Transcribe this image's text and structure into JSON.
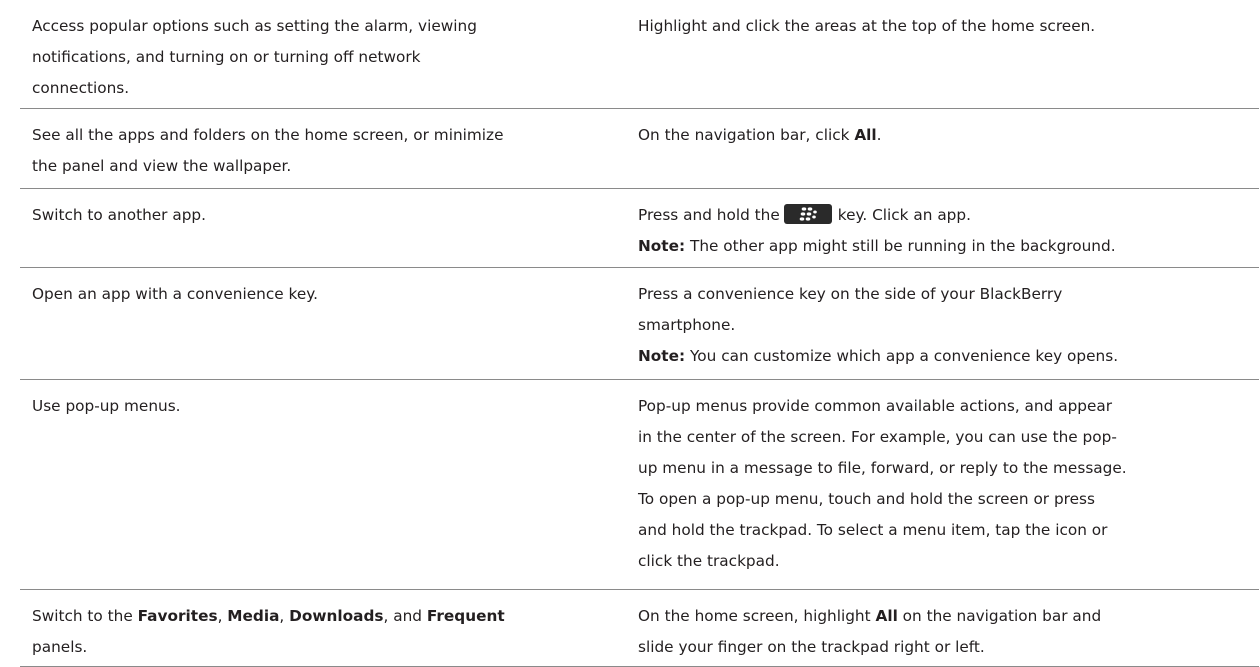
{
  "rows": [
    {
      "action_lines": [
        "Access popular options such as setting the alarm, viewing",
        "notifications, and turning on or turning off network",
        "connections."
      ],
      "instruction": "Highlight and click the areas at the top of the home screen."
    },
    {
      "action_lines": [
        "See all the apps and folders on the home screen, or minimize",
        "the panel and view the wallpaper."
      ],
      "instruction_prefix": "On the navigation bar, click ",
      "instruction_bold": "All",
      "instruction_suffix": "."
    },
    {
      "action": "Switch to another app.",
      "instruction_prefix": "Press and hold the",
      "key_icon": "blackberry-menu-key-icon",
      "instruction_suffix": "key. Click an app.",
      "note_label": "Note:",
      "note_text": " The other app might still be running in the background."
    },
    {
      "action": "Open an app with a convenience key.",
      "instruction_lines": [
        "Press a convenience key on the side of your BlackBerry",
        "smartphone."
      ],
      "note_label": "Note:",
      "note_text": " You can customize which app a convenience key opens."
    },
    {
      "action": "Use pop-up menus.",
      "instruction_lines": [
        "Pop-up menus provide common available actions, and appear",
        "in the center of the screen. For example, you can use the pop-",
        "up menu in a message to file, forward, or reply to the message.",
        "To open a pop-up menu, touch and hold the screen or press",
        "and hold the trackpad. To select a menu item, tap the icon or",
        "click the trackpad."
      ]
    },
    {
      "action_parts": {
        "t1": "Switch to the ",
        "b1": "Favorites",
        "t2": ", ",
        "b2": "Media",
        "t3": ", ",
        "b3": "Downloads",
        "t4": ", and ",
        "b4": "Frequent",
        "t5": "panels."
      },
      "instruction_parts": {
        "t1": "On the home screen, highlight ",
        "b1": "All",
        "t2": " on the navigation bar and",
        "t3": "slide your finger on the trackpad right or left."
      }
    }
  ],
  "colors": {
    "text": "#231f20",
    "rule": "#8a8a8a",
    "key_bg": "#2a2a2a"
  }
}
